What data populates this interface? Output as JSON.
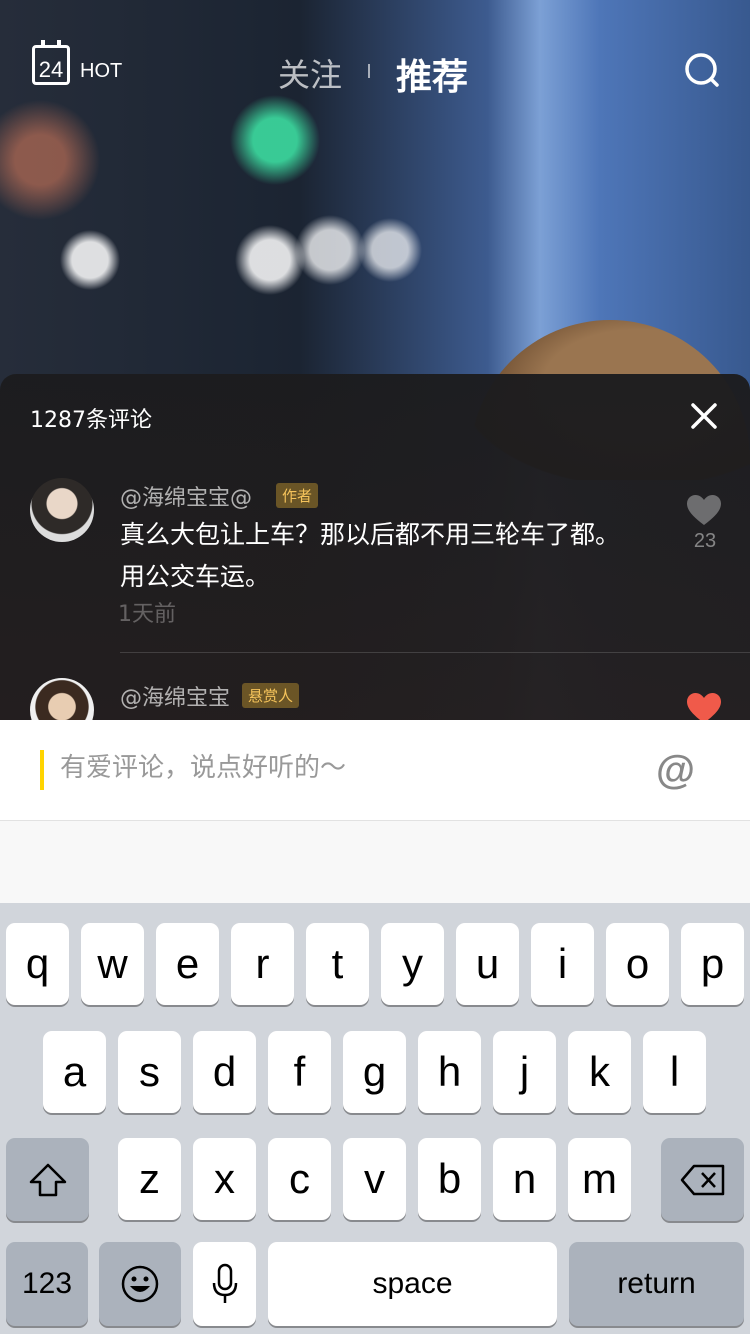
{
  "topbar": {
    "calendar_day": "24",
    "hot_label": "HOT",
    "tab_follow": "关注",
    "tab_recommend": "推荐"
  },
  "comments": {
    "count_label": "1287条评论",
    "items": [
      {
        "username": "@海绵宝宝@",
        "badge": "作者",
        "text": "真么大包让上车？那以后都不用三轮车了都。用公交车运。",
        "time": "1天前",
        "likes": "23",
        "liked": false
      },
      {
        "username": "@海绵宝宝",
        "badge": "悬赏人",
        "liked": true
      }
    ]
  },
  "input": {
    "placeholder": "有爱评论，说点好听的～",
    "mention_symbol": "@"
  },
  "keyboard": {
    "row1": [
      "q",
      "w",
      "e",
      "r",
      "t",
      "y",
      "u",
      "i",
      "o",
      "p"
    ],
    "row2": [
      "a",
      "s",
      "d",
      "f",
      "g",
      "h",
      "j",
      "k",
      "l"
    ],
    "row3": [
      "z",
      "x",
      "c",
      "v",
      "b",
      "n",
      "m"
    ],
    "key_123": "123",
    "key_space": "space",
    "key_return": "return"
  },
  "colors": {
    "caret": "#ffd400",
    "badge_text": "#f5c35b",
    "like_active": "#f05a4a",
    "keyboard_bg": "#d1d5db"
  },
  "icons": {
    "search": "search-icon",
    "close": "close-icon",
    "heart": "heart-icon",
    "shift": "shift-icon",
    "delete": "delete-icon",
    "emoji": "emoji-icon",
    "mic": "microphone-icon"
  }
}
